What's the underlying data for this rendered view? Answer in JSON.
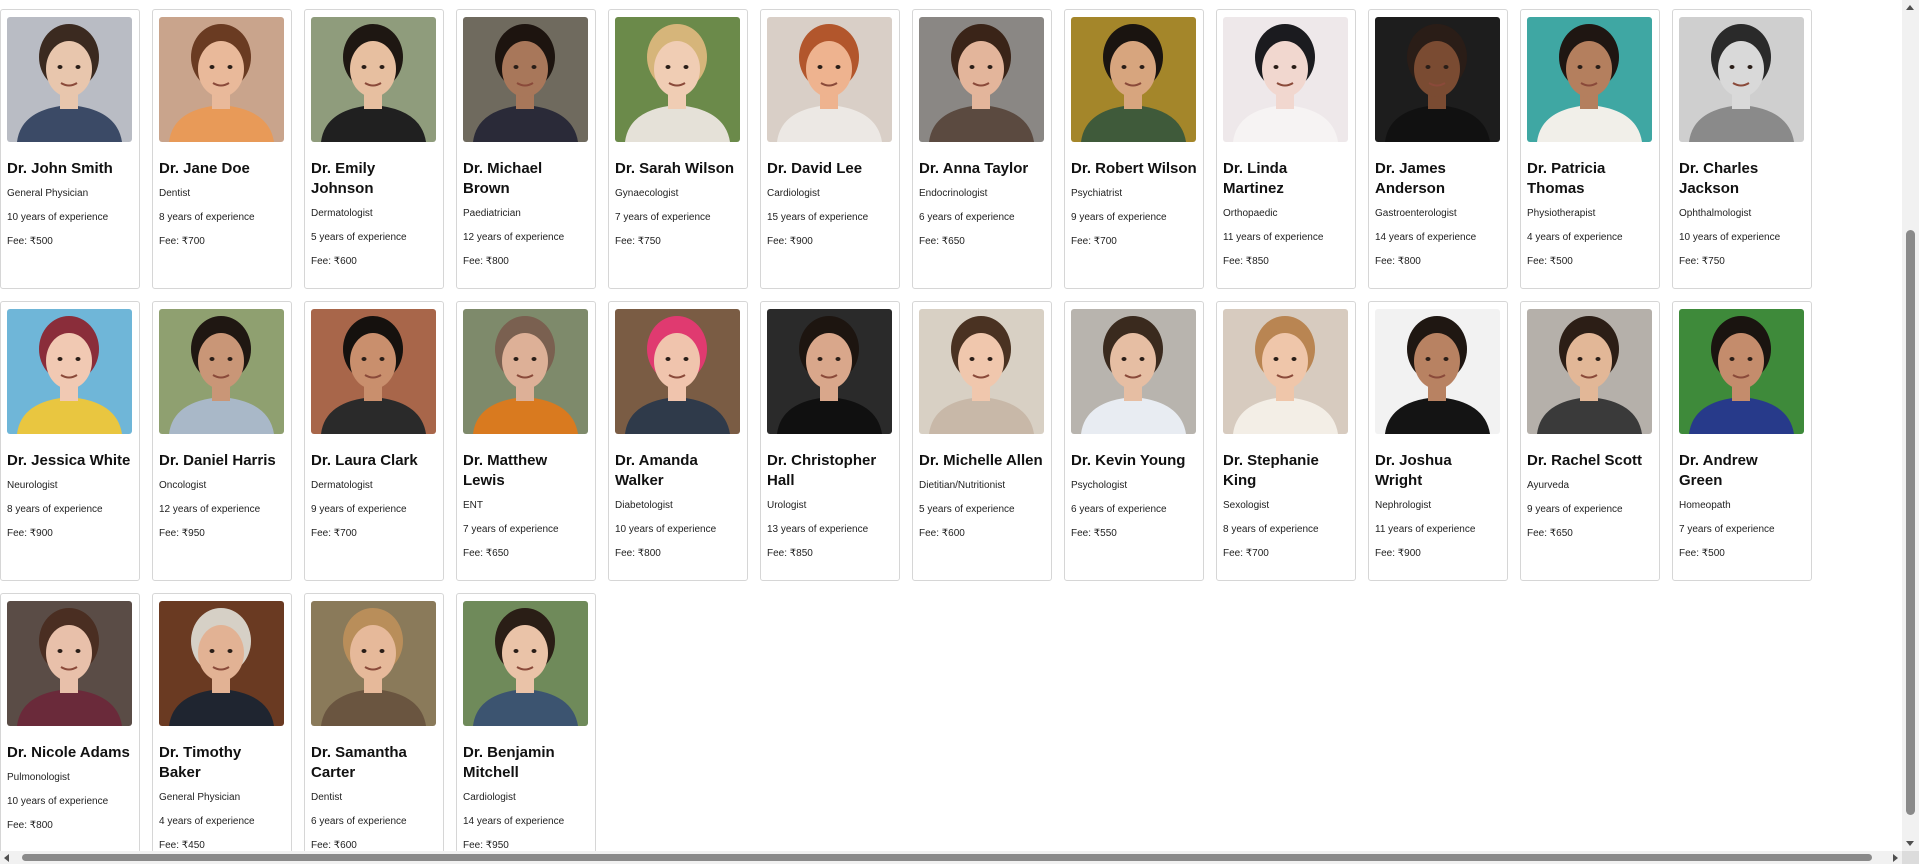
{
  "doctors": [
    {
      "name": "Dr. John Smith",
      "specialty": "General Physician",
      "experience": "10 years of experience",
      "fee": "Fee: ₹500",
      "bg": "#b9bcc4",
      "skin": "#e8c6ad",
      "hair": "#3b2a20",
      "shirt": "#3b4a66"
    },
    {
      "name": "Dr. Jane Doe",
      "specialty": "Dentist",
      "experience": "8 years of experience",
      "fee": "Fee: ₹700",
      "bg": "#c9a48c",
      "skin": "#e9b99a",
      "hair": "#6a3b22",
      "shirt": "#e89a58"
    },
    {
      "name": "Dr. Emily Johnson",
      "specialty": "Dermatologist",
      "experience": "5 years of experience",
      "fee": "Fee: ₹600",
      "bg": "#8f9c7c",
      "skin": "#e7bfa0",
      "hair": "#1e1712",
      "shirt": "#202020"
    },
    {
      "name": "Dr. Michael Brown",
      "specialty": "Paediatrician",
      "experience": "12 years of experience",
      "fee": "Fee: ₹800",
      "bg": "#6f6a5e",
      "skin": "#a8775a",
      "hair": "#1d140f",
      "shirt": "#2a2a38"
    },
    {
      "name": "Dr. Sarah Wilson",
      "specialty": "Gynaecologist",
      "experience": "7 years of experience",
      "fee": "Fee: ₹750",
      "bg": "#6b8a4a",
      "skin": "#f0cdb4",
      "hair": "#d6b57a",
      "shirt": "#e5e1d8"
    },
    {
      "name": "Dr. David Lee",
      "specialty": "Cardiologist",
      "experience": "15 years of experience",
      "fee": "Fee: ₹900",
      "bg": "#d9cfc7",
      "skin": "#eeb38f",
      "hair": "#b2562c",
      "shirt": "#ece8e4"
    },
    {
      "name": "Dr. Anna Taylor",
      "specialty": "Endocrinologist",
      "experience": "6 years of experience",
      "fee": "Fee: ₹650",
      "bg": "#8a8784",
      "skin": "#e3b59b",
      "hair": "#3a2418",
      "shirt": "#5b4a40"
    },
    {
      "name": "Dr. Robert Wilson",
      "specialty": "Psychiatrist",
      "experience": "9 years of experience",
      "fee": "Fee: ₹700",
      "bg": "#a4862a",
      "skin": "#d7a57e",
      "hair": "#1a1410",
      "shirt": "#3f5a3a"
    },
    {
      "name": "Dr. Linda Martinez",
      "specialty": "Orthopaedic",
      "experience": "11 years of experience",
      "fee": "Fee: ₹850",
      "bg": "#eee8ea",
      "skin": "#f1d7cf",
      "hair": "#1b1b1f",
      "shirt": "#f6f3f3"
    },
    {
      "name": "Dr. James Anderson",
      "specialty": "Gastroenterologist",
      "experience": "14 years of experience",
      "fee": "Fee: ₹800",
      "bg": "#1d1d1d",
      "skin": "#7a4b32",
      "hair": "#2a1d17",
      "shirt": "#111111"
    },
    {
      "name": "Dr. Patricia Thomas",
      "specialty": "Physiotherapist",
      "experience": "4 years of experience",
      "fee": "Fee: ₹500",
      "bg": "#3fa7a3",
      "skin": "#b47f5e",
      "hair": "#1f1612",
      "shirt": "#f1efe9"
    },
    {
      "name": "Dr. Charles Jackson",
      "specialty": "Ophthalmologist",
      "experience": "10 years of experience",
      "fee": "Fee: ₹750",
      "bg": "#cfcfcf",
      "skin": "#d9d9d9",
      "hair": "#2a2a2a",
      "shirt": "#8a8a8a"
    },
    {
      "name": "Dr. Jessica White",
      "specialty": "Neurologist",
      "experience": "8 years of experience",
      "fee": "Fee: ₹900",
      "bg": "#6fb6d8",
      "skin": "#f1c9b3",
      "hair": "#8a2d3a",
      "shirt": "#e9c640"
    },
    {
      "name": "Dr. Daniel Harris",
      "specialty": "Oncologist",
      "experience": "12 years of experience",
      "fee": "Fee: ₹950",
      "bg": "#8fa070",
      "skin": "#c99677",
      "hair": "#1f1712",
      "shirt": "#a9b8c8"
    },
    {
      "name": "Dr. Laura Clark",
      "specialty": "Dermatologist",
      "experience": "9 years of experience",
      "fee": "Fee: ₹700",
      "bg": "#a8664a",
      "skin": "#c98f6d",
      "hair": "#15110e",
      "shirt": "#2a2a2a"
    },
    {
      "name": "Dr. Matthew Lewis",
      "specialty": "ENT",
      "experience": "7 years of experience",
      "fee": "Fee: ₹650",
      "bg": "#7e8a6b",
      "skin": "#ddb097",
      "hair": "#7a6050",
      "shirt": "#d97a1f"
    },
    {
      "name": "Dr. Amanda Walker",
      "specialty": "Diabetologist",
      "experience": "10 years of experience",
      "fee": "Fee: ₹800",
      "bg": "#7a5c44",
      "skin": "#f0c4ad",
      "hair": "#e03a70",
      "shirt": "#2f3a4a"
    },
    {
      "name": "Dr. Christopher Hall",
      "specialty": "Urologist",
      "experience": "13 years of experience",
      "fee": "Fee: ₹850",
      "bg": "#2a2a2a",
      "skin": "#d9a78b",
      "hair": "#1d1510",
      "shirt": "#101010"
    },
    {
      "name": "Dr. Michelle Allen",
      "specialty": "Dietitian/Nutritionist",
      "experience": "5 years of experience",
      "fee": "Fee: ₹600",
      "bg": "#d8d0c4",
      "skin": "#f0c7ad",
      "hair": "#4a3222",
      "shirt": "#c8b8a8"
    },
    {
      "name": "Dr. Kevin Young",
      "specialty": "Psychologist",
      "experience": "6 years of experience",
      "fee": "Fee: ₹550",
      "bg": "#b8b4ae",
      "skin": "#e6bea3",
      "hair": "#3a2a1e",
      "shirt": "#e8ecf2"
    },
    {
      "name": "Dr. Stephanie King",
      "specialty": "Sexologist",
      "experience": "8 years of experience",
      "fee": "Fee: ₹700",
      "bg": "#d7cbbf",
      "skin": "#efc6aa",
      "hair": "#b98552",
      "shirt": "#f3eee6"
    },
    {
      "name": "Dr. Joshua Wright",
      "specialty": "Nephrologist",
      "experience": "11 years of experience",
      "fee": "Fee: ₹900",
      "bg": "#f2f2f2",
      "skin": "#b88262",
      "hair": "#1f1712",
      "shirt": "#141414"
    },
    {
      "name": "Dr. Rachel Scott",
      "specialty": "Ayurveda",
      "experience": "9 years of experience",
      "fee": "Fee: ₹650",
      "bg": "#b5b0aa",
      "skin": "#e2b797",
      "hair": "#2c1e16",
      "shirt": "#3a3a3a"
    },
    {
      "name": "Dr. Andrew Green",
      "specialty": "Homeopath",
      "experience": "7 years of experience",
      "fee": "Fee: ₹500",
      "bg": "#3e8a3a",
      "skin": "#c48c6c",
      "hair": "#1a1410",
      "shirt": "#273a8a"
    },
    {
      "name": "Dr. Nicole Adams",
      "specialty": "Pulmonologist",
      "experience": "10 years of experience",
      "fee": "Fee: ₹800",
      "bg": "#5a4c46",
      "skin": "#e8c0aa",
      "hair": "#4a2e22",
      "shirt": "#6a2a3a"
    },
    {
      "name": "Dr. Timothy Baker",
      "specialty": "General Physician",
      "experience": "4 years of experience",
      "fee": "Fee: ₹450",
      "bg": "#6a3a22",
      "skin": "#e2b294",
      "hair": "#d6d0c6",
      "shirt": "#1f2530"
    },
    {
      "name": "Dr. Samantha Carter",
      "specialty": "Dentist",
      "experience": "6 years of experience",
      "fee": "Fee: ₹600",
      "bg": "#8a7a5a",
      "skin": "#e6b99a",
      "hair": "#b98e5a",
      "shirt": "#6a5540"
    },
    {
      "name": "Dr. Benjamin Mitchell",
      "specialty": "Cardiologist",
      "experience": "14 years of experience",
      "fee": "Fee: ₹950",
      "bg": "#6f8a5a",
      "skin": "#eac3a8",
      "hair": "#2a1e16",
      "shirt": "#3c5470"
    }
  ]
}
